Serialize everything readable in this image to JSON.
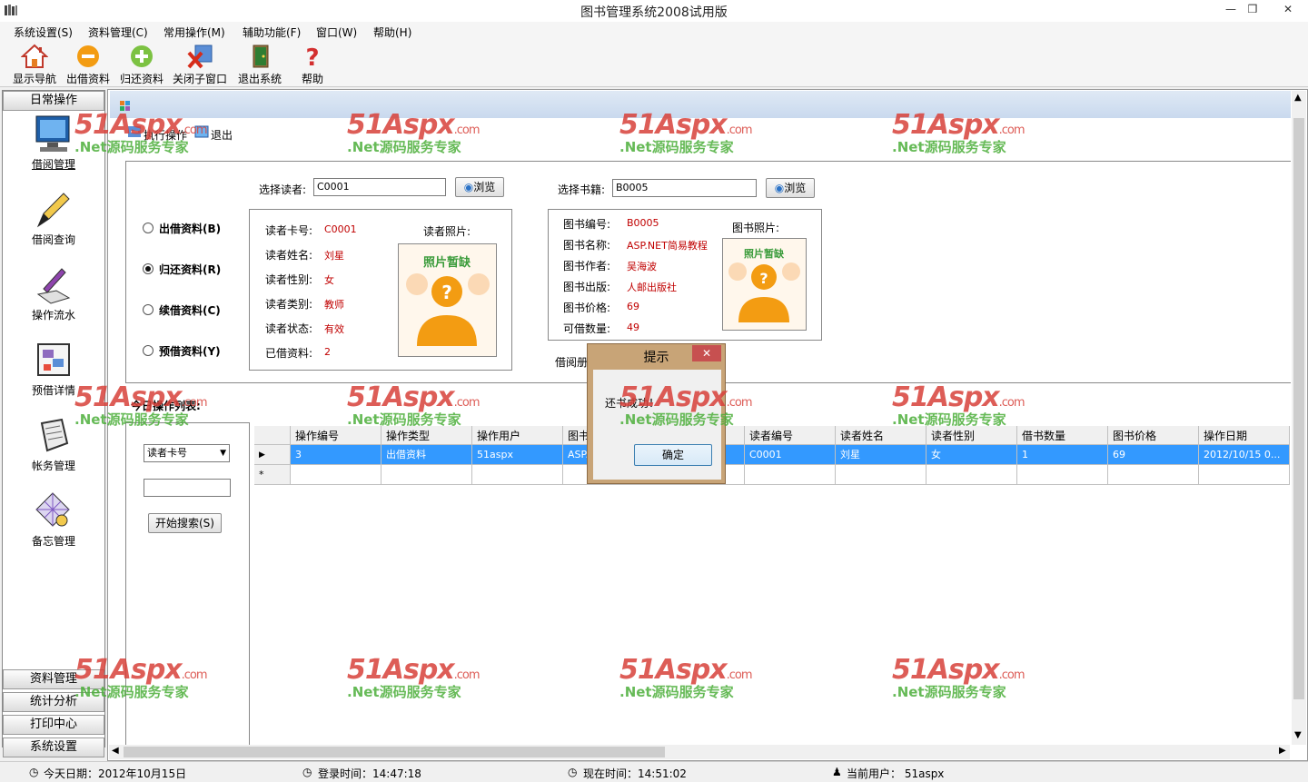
{
  "window": {
    "title": "图书管理系统2008试用版",
    "min": "—",
    "restore": "❒",
    "close": "✕"
  },
  "menu": [
    "系统设置(S)",
    "资料管理(C)",
    "常用操作(M)",
    "辅助功能(F)",
    "窗口(W)",
    "帮助(H)"
  ],
  "toolbar": [
    "显示导航",
    "出借资料",
    "归还资料",
    "关闭子窗口",
    "退出系统",
    "帮助"
  ],
  "nav": {
    "header": "日常操作",
    "items": [
      "借阅管理",
      "借阅查询",
      "操作流水",
      "预借详情",
      "帐务管理",
      "备忘管理"
    ],
    "sections": [
      "资料管理",
      "统计分析",
      "打印中心",
      "系统设置"
    ]
  },
  "child": {
    "exec": "执行操作",
    "exit": "退出",
    "reader_label": "选择读者:",
    "reader_value": "C0001",
    "book_label": "选择书籍:",
    "book_value": "B0005",
    "browse": "浏览",
    "modes": [
      "出借资料(B)",
      "归还资料(R)",
      "续借资料(C)",
      "预借资料(Y)"
    ],
    "selected_mode": 1,
    "reader": {
      "labels": [
        "读者卡号:",
        "读者姓名:",
        "读者性别:",
        "读者类别:",
        "读者状态:",
        "已借资料:"
      ],
      "values": [
        "C0001",
        "刘星",
        "女",
        "教师",
        "有效",
        "2"
      ],
      "photo_label": "读者照片:"
    },
    "book": {
      "labels": [
        "图书编号:",
        "图书名称:",
        "图书作者:",
        "图书出版:",
        "图书价格:",
        "可借数量:"
      ],
      "values": [
        "B0005",
        "ASP.NET简易教程",
        "吴海波",
        "人邮出版社",
        "69",
        "49"
      ],
      "photo_label": "图书照片:"
    },
    "photo_text": "照片暂缺",
    "borrow_label": "借阅册",
    "today_list": "今日操作列表:",
    "search_field": "读者卡号",
    "search_button": "开始搜索(S)"
  },
  "grid": {
    "columns": [
      "操作编号",
      "操作类型",
      "操作用户",
      "图书",
      "",
      "读者编号",
      "读者姓名",
      "读者性别",
      "借书数量",
      "图书价格",
      "操作日期"
    ],
    "rows": [
      [
        "3",
        "出借资料",
        "51aspx",
        "ASP.",
        "",
        "C0001",
        "刘星",
        "女",
        "1",
        "69",
        "2012/10/15 0..."
      ]
    ],
    "new_row_marker": "*",
    "current_marker": "▶"
  },
  "dialog": {
    "title": "提示",
    "message": "还书成功！",
    "ok": "确定",
    "close": "✕"
  },
  "status": {
    "today": "今天日期：2012年10月15日",
    "login": "登录时间：14:47:18",
    "now": "现在时间：14:51:02",
    "user": "当前用户：  51aspx"
  },
  "watermark": {
    "brand": "51Aspx",
    "suffix": ".com",
    "slogan": ".Net源码服务专家"
  },
  "colors": {
    "selection": "#3399ff",
    "value_red": "#c00000",
    "dialog_frame": "#c8a477",
    "close_red": "#c75050"
  }
}
